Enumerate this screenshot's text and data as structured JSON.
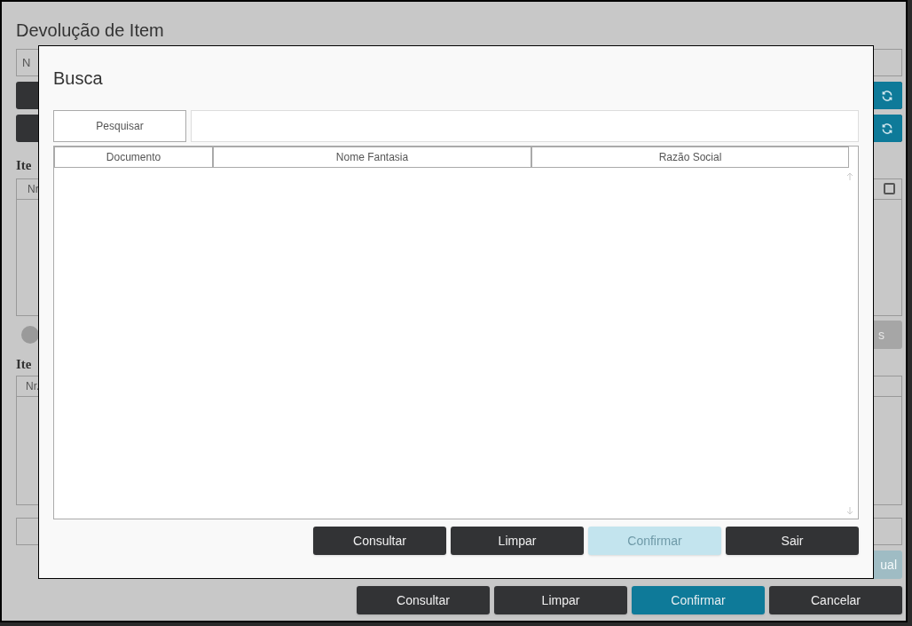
{
  "window": {
    "title": "Devolução de Item"
  },
  "background": {
    "field_1": {
      "text": "N"
    },
    "refresh_rows": [
      {
        "kind": "refresh"
      },
      {
        "kind": "refresh"
      }
    ],
    "section_1": {
      "heading": "Ite",
      "column_1": "Nr",
      "select_all": {
        "checked": false
      }
    },
    "toggle": {
      "on": false
    },
    "button_1": {
      "label": "s",
      "disabled": true
    },
    "section_2": {
      "heading": "Ite",
      "column_1": "Nr."
    },
    "button_2": {
      "label": "ual",
      "disabled": true
    },
    "buttons": [
      {
        "label": "Consultar",
        "kind": "dark",
        "disabled": false
      },
      {
        "label": "Limpar",
        "kind": "dark",
        "disabled": false
      },
      {
        "label": "Confirmar",
        "kind": "primary",
        "disabled": false
      },
      {
        "label": "Cancelar",
        "kind": "dark",
        "disabled": false
      }
    ]
  },
  "dialog": {
    "title": "Busca",
    "search_button": "Pesquisar",
    "table": {
      "columns": [
        "Documento",
        "Nome Fantasia",
        "Razão Social"
      ]
    },
    "buttons": [
      {
        "label": "Consultar",
        "kind": "dark",
        "disabled": false
      },
      {
        "label": "Limpar",
        "kind": "dark",
        "disabled": false
      },
      {
        "label": "Confirmar",
        "kind": "primary",
        "disabled": true
      },
      {
        "label": "Sair",
        "kind": "dark",
        "disabled": false
      }
    ]
  }
}
